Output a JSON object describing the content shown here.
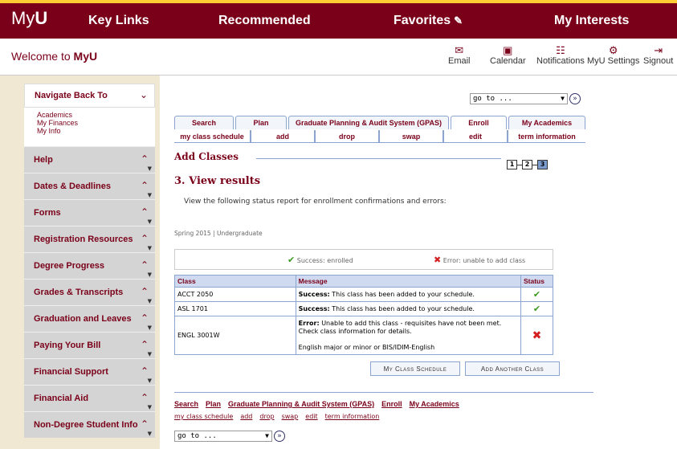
{
  "topbar": {
    "logo_light": "My",
    "logo_bold": "U",
    "nav": [
      "Key Links",
      "Recommended",
      "Favorites",
      "My Interests"
    ]
  },
  "welcome": {
    "prefix": "Welcome to ",
    "bold": "MyU"
  },
  "utility": [
    {
      "label": "Email",
      "icon": "envelope-icon"
    },
    {
      "label": "Calendar",
      "icon": "calendar-icon"
    },
    {
      "label": "Notifications",
      "icon": "notifications-icon"
    },
    {
      "label": "MyU Settings",
      "icon": "settings-icon"
    },
    {
      "label": "Signout",
      "icon": "signout-icon"
    }
  ],
  "sidebar": {
    "nav_back_title": "Navigate Back To",
    "nav_back_links": [
      "Academics",
      "My Finances",
      "My Info"
    ],
    "items": [
      "Help",
      "Dates & Deadlines",
      "Forms",
      "Registration Resources",
      "Degree Progress",
      "Grades & Transcripts",
      "Graduation and Leaves",
      "Paying Your Bill",
      "Financial Support",
      "Financial Aid",
      "Non-Degree Student Info"
    ]
  },
  "goto": {
    "label": "go to ...",
    "go": "»"
  },
  "tabs": [
    "Search",
    "Plan",
    "Graduate Planning & Audit System (GPAS)",
    "Enroll",
    "My Academics"
  ],
  "active_tab": "Enroll",
  "subtabs": [
    "my class schedule",
    "add",
    "drop",
    "swap",
    "edit",
    "term information"
  ],
  "active_subtab": "add",
  "section_title": "Add Classes",
  "steps": [
    "1",
    "2",
    "3"
  ],
  "current_step": "3",
  "heading": "3. View results",
  "intro": "View the following status report for enrollment confirmations and errors:",
  "term": "Spring 2015 | Undergraduate",
  "legend": {
    "success": "Success: enrolled",
    "error": "Error: unable to add class"
  },
  "table": {
    "headers": [
      "Class",
      "Message",
      "Status"
    ],
    "rows": [
      {
        "class": "ACCT 2050",
        "bold": "Success:",
        "msg": " This class has been added to your schedule.",
        "status": "success"
      },
      {
        "class": "ASL 1701",
        "bold": "Success:",
        "msg": " This class has been added to your schedule.",
        "status": "success"
      },
      {
        "class": "ENGL 3001W",
        "bold": "Error:",
        "msg": " Unable to add this class - requisites have not been met. Check class information for details.",
        "extra": "English major or minor or BIS/IDIM-English",
        "status": "error"
      }
    ]
  },
  "buttons": {
    "schedule": "My Class Schedule",
    "add_another": "Add Another Class"
  },
  "bottom_links": [
    "Search",
    "Plan",
    "Graduate Planning & Audit System (GPAS)",
    "Enroll",
    "My Academics"
  ],
  "bottom_sub": [
    "my class schedule",
    "add",
    "drop",
    "swap",
    "edit",
    "term information"
  ],
  "colors": {
    "maroon": "#7a0019",
    "gold": "#ffcc33",
    "success": "#3a9a1d",
    "error": "#d42020"
  }
}
